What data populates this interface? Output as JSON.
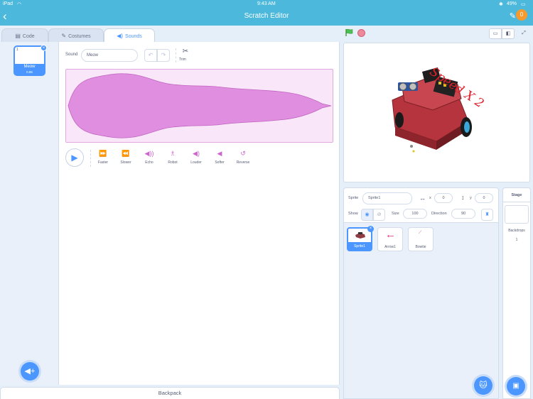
{
  "status": {
    "device": "iPad",
    "time": "9:43 AM",
    "battery": "49%"
  },
  "app": {
    "title": "Scratch Editor",
    "badge": "0",
    "accent": "#4c97ff",
    "header_color": "#4cb8dc"
  },
  "tabs": [
    {
      "label": "Code",
      "icon": "code-icon"
    },
    {
      "label": "Costumes",
      "icon": "brush-icon"
    },
    {
      "label": "Sounds",
      "icon": "speaker-icon",
      "active": true
    }
  ],
  "sound_list": [
    {
      "number": "1",
      "name": "Meow",
      "duration": "0.85"
    }
  ],
  "editor": {
    "sound_label": "Sound",
    "sound_name": "Meow",
    "trim_label": "Trim",
    "waveform_color": "#cf63cf",
    "effects": [
      {
        "label": "Faster",
        "icon": "faster-icon"
      },
      {
        "label": "Slower",
        "icon": "slower-icon"
      },
      {
        "label": "Echo",
        "icon": "echo-icon"
      },
      {
        "label": "Robot",
        "icon": "robot-icon"
      },
      {
        "label": "Louder",
        "icon": "louder-icon"
      },
      {
        "label": "Softer",
        "icon": "softer-icon"
      },
      {
        "label": "Reverse",
        "icon": "reverse-icon"
      }
    ]
  },
  "backpack": {
    "label": "Backpack"
  },
  "stage": {
    "overlay_text": "Speed X 2"
  },
  "sprite_info": {
    "sprite_label": "Sprite",
    "sprite_name": "Sprite1",
    "x_label": "x",
    "x_value": "0",
    "y_label": "y",
    "y_value": "0",
    "show_label": "Show",
    "size_label": "Size",
    "size_value": "100",
    "direction_label": "Direction",
    "direction_value": "90"
  },
  "sprites": [
    {
      "name": "Sprite1",
      "selected": true
    },
    {
      "name": "Arrow1"
    },
    {
      "name": "Bowtie"
    }
  ],
  "stage_pane": {
    "title": "Stage",
    "backdrops_label": "Backdrops",
    "backdrops_count": "1"
  }
}
